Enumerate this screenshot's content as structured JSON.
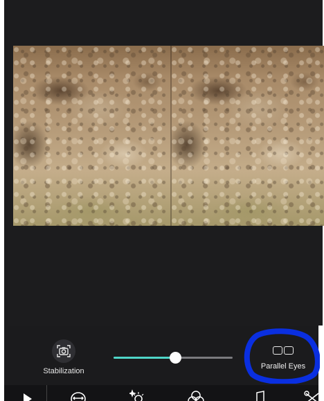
{
  "controls": {
    "stabilization": {
      "label": "Stabilization",
      "icon": "camera-stabilize-icon"
    },
    "intensity_slider": {
      "value_fraction": 0.52,
      "fill_color": "#4fd6c8",
      "track_color": "#7a7a7e"
    },
    "parallel_eyes": {
      "label": "Parallel Eyes",
      "icon": "parallel-eyes-icon",
      "annotation_color": "#0a2fe0"
    }
  },
  "toolbar": {
    "items": [
      {
        "icon": "play-icon"
      },
      {
        "icon": "transform-icon"
      },
      {
        "icon": "adjust-sparkle-icon"
      },
      {
        "icon": "filters-icon"
      },
      {
        "icon": "music-note-icon"
      },
      {
        "icon": "scissors-icon"
      }
    ]
  }
}
